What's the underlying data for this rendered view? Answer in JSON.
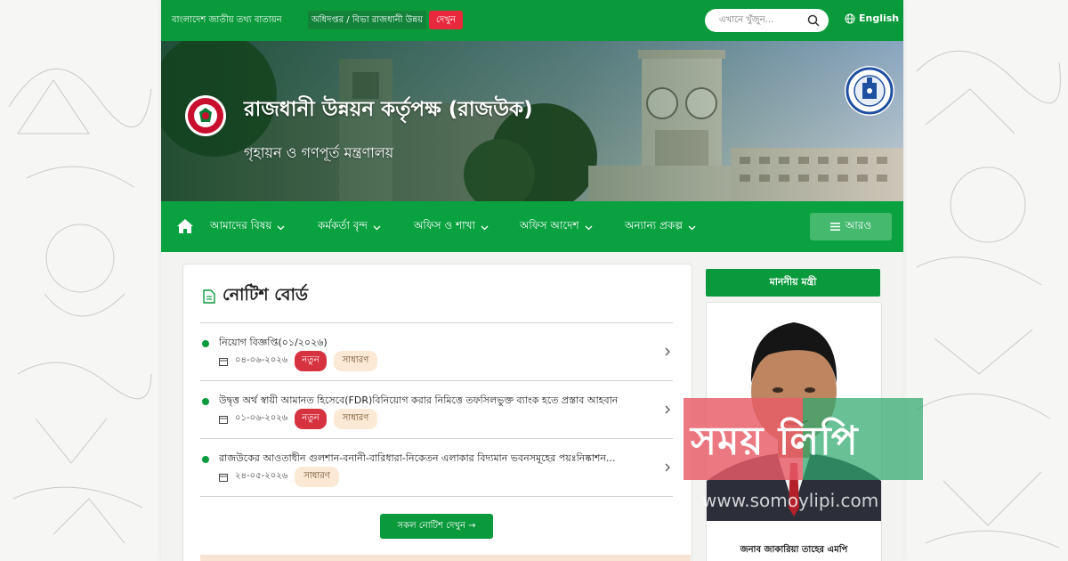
{
  "topbar": {
    "portal_name": "বাংলাদেশ জাতীয় তথ্য বাতায়ন",
    "ticker_label": "অধিদপ্তর / বিভা রাজধানী উন্নয়",
    "ticker_button": "দেখুন",
    "search_placeholder": "এখানে খুঁজুন...",
    "language": "English"
  },
  "banner": {
    "title": "রাজধানী উন্নয়ন কর্তৃপক্ষ (রাজউক)",
    "subtitle": "গৃহায়ন ও গণপূর্ত মন্ত্রণালয়"
  },
  "nav": {
    "items": [
      {
        "label": "আমাদের বিষয়"
      },
      {
        "label": "কর্মকর্তা বৃন্দ"
      },
      {
        "label": "অফিস ও শাখা"
      },
      {
        "label": "অফিস আদেশ"
      },
      {
        "label": "অন্যান্য প্রকল্প"
      }
    ],
    "more": "আরও"
  },
  "notice_board": {
    "heading": "নোটিশ বোর্ড",
    "items": [
      {
        "title": "নিয়োগ বিজ্ঞপ্তি(০১/২০২৬)",
        "date": "০৪-০৬-২০২৬",
        "tags": [
          "নতুন",
          "সাধারণ"
        ]
      },
      {
        "title": "উদ্বৃত্ত অর্থ স্বায়ী আমানত হিসেবে(FDR)বিনিয়োগ করার নিমিত্তে তফসিলভুক্ত ব্যাংক হতে প্রস্তাব আহবান",
        "date": "০১-০৬-২০২৬",
        "tags": [
          "নতুন",
          "সাধারণ"
        ]
      },
      {
        "title": "রাজউকের আওতাধীন গুলশান-বনানী-বারিধারা-নিকেতন এলাকার বিদ্যমান ভবনসমূহের পয়ঃনিষ্কাশন...",
        "date": "২৪-০৫-২০২৬",
        "tags": [
          "সাধারণ"
        ]
      }
    ],
    "all_button": "সকল নোটিশ দেখুন →"
  },
  "minister": {
    "heading": "মাননীয় মন্ত্রী",
    "name": "জনাব জাকারিয়া তাহের এমপি"
  },
  "watermark": {
    "text": "সময় লিপি",
    "url": "www.somoylipi.com"
  },
  "colors": {
    "primary_green": "#0a9a3c",
    "nav_green": "#0aa241",
    "tag_red": "#d6323f",
    "tag_peach": "#fbe9d5"
  }
}
